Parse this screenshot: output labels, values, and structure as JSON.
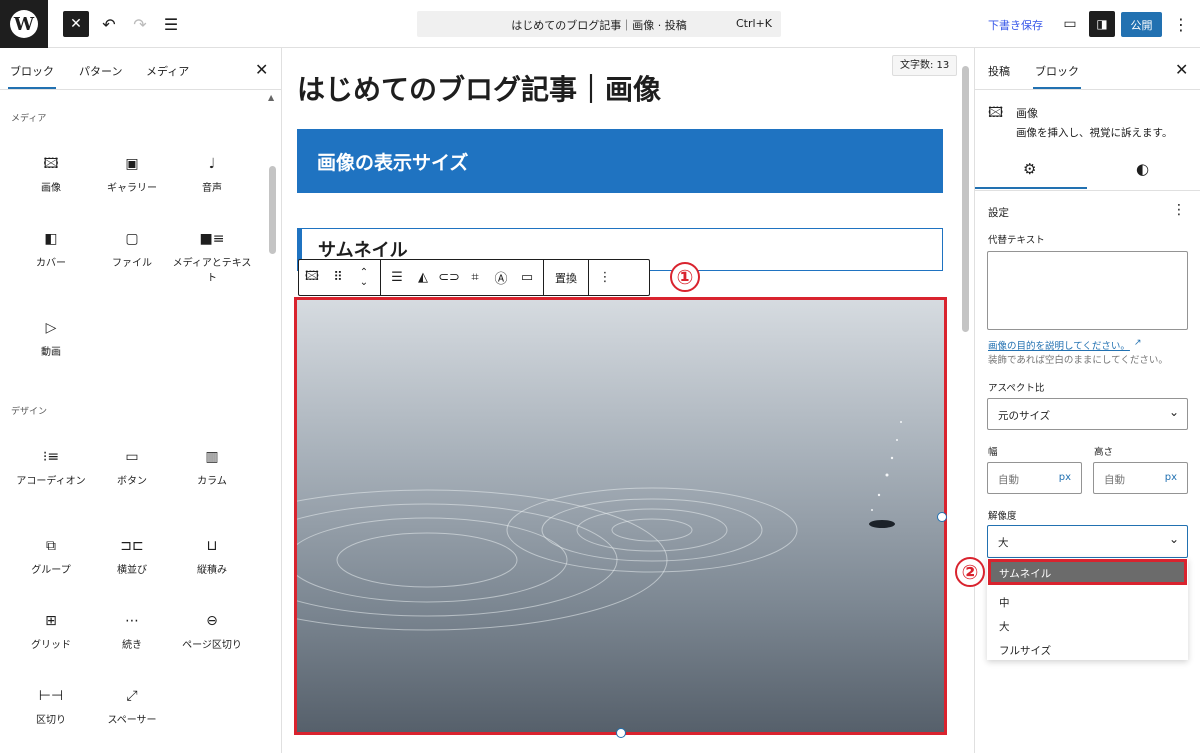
{
  "topbar": {
    "search_label": "はじめてのブログ記事｜画像 · 投稿",
    "shortcut": "Ctrl+K",
    "save_draft": "下書き保存",
    "publish": "公開"
  },
  "left_sidebar": {
    "tabs": [
      "ブロック",
      "パターン",
      "メディア"
    ],
    "categories": [
      "メディア",
      "デザイン"
    ],
    "media_blocks": [
      {
        "icon": "image-icon",
        "label": "画像"
      },
      {
        "icon": "gallery-icon",
        "label": "ギャラリー"
      },
      {
        "icon": "audio-icon",
        "label": "音声"
      },
      {
        "icon": "cover-icon",
        "label": "カバー"
      },
      {
        "icon": "file-icon",
        "label": "ファイル"
      },
      {
        "icon": "media-text-icon",
        "label": "メディアとテキスト"
      },
      {
        "icon": "video-icon",
        "label": "動画"
      }
    ],
    "design_blocks": [
      {
        "icon": "accordion-icon",
        "label": "アコーディオン"
      },
      {
        "icon": "buttons-icon",
        "label": "ボタン"
      },
      {
        "icon": "columns-icon",
        "label": "カラム"
      },
      {
        "icon": "group-icon",
        "label": "グループ"
      },
      {
        "icon": "row-icon",
        "label": "横並び"
      },
      {
        "icon": "stack-icon",
        "label": "縦積み"
      },
      {
        "icon": "grid-icon",
        "label": "グリッド"
      },
      {
        "icon": "more-icon",
        "label": "続き"
      },
      {
        "icon": "page-break-icon",
        "label": "ページ区切り"
      },
      {
        "icon": "separator-icon",
        "label": "区切り"
      },
      {
        "icon": "spacer-icon",
        "label": "スペーサー"
      }
    ]
  },
  "editor": {
    "word_count": "文字数: 13",
    "post_title": "はじめてのブログ記事｜画像",
    "heading2": "画像の表示サイズ",
    "heading3": "サムネイル",
    "replace_button": "置換",
    "annotation_1": "①",
    "annotation_2": "②"
  },
  "right_sidebar": {
    "tabs": [
      "投稿",
      "ブロック"
    ],
    "block_name": "画像",
    "block_desc": "画像を挿入し、視覚に訴えます。",
    "settings_title": "設定",
    "alt_label": "代替テキスト",
    "alt_link": "画像の目的を説明してください。",
    "alt_help": "装飾であれば空白のままにしてください。",
    "aspect_label": "アスペクト比",
    "aspect_value": "元のサイズ",
    "width_label": "幅",
    "height_label": "高さ",
    "width_placeholder": "自動",
    "height_placeholder": "自動",
    "unit": "px",
    "resolution_label": "解像度",
    "resolution_value": "大",
    "resolution_options": [
      "サムネイル",
      "中",
      "大",
      "フルサイズ"
    ]
  },
  "colors": {
    "accent": "#2271b1",
    "heading_bg": "#1f73c1",
    "annotation": "#d9232e"
  }
}
